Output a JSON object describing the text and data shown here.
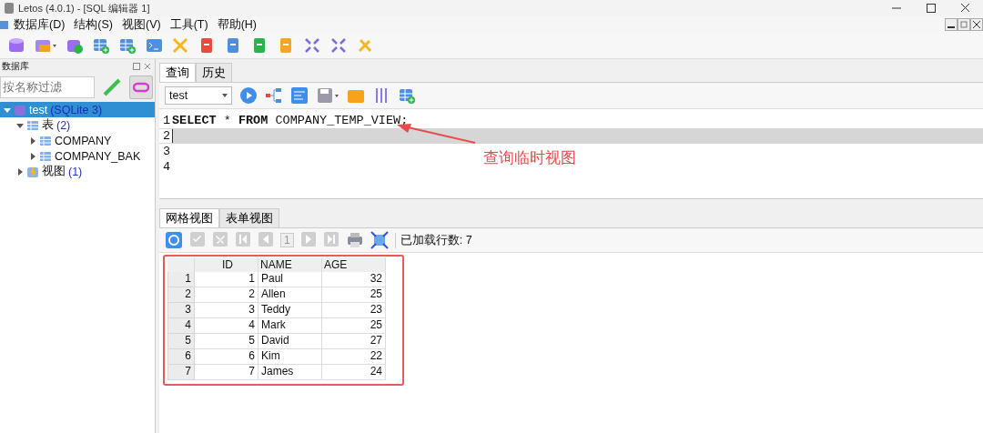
{
  "window": {
    "title": "Letos (4.0.1) - [SQL 编辑器 1]"
  },
  "menu": [
    "数据库(D)",
    "结构(S)",
    "视图(V)",
    "工具(T)",
    "帮助(H)"
  ],
  "left_panel": {
    "title": "数据库",
    "filter": {
      "placeholder": "按名称过滤"
    },
    "tree": [
      {
        "label": "test",
        "count": "(SQLite 3)",
        "expanded": true,
        "selected": true,
        "kind": "database",
        "children": [
          {
            "label": "表",
            "count": "(2)",
            "expanded": true,
            "selected": false,
            "kind": "tables",
            "children": [
              {
                "label": "COMPANY",
                "expanded": false,
                "selected": false,
                "kind": "table"
              },
              {
                "label": "COMPANY_BAK",
                "expanded": false,
                "selected": false,
                "kind": "table"
              }
            ]
          },
          {
            "label": "视图",
            "count": "(1)",
            "expanded": false,
            "selected": false,
            "kind": "views"
          }
        ]
      }
    ]
  },
  "query_tabs": [
    {
      "label": "查询",
      "selected": true
    },
    {
      "label": "历史",
      "selected": false
    }
  ],
  "connection": {
    "value": "test"
  },
  "editor": {
    "lines": [
      {
        "number": "1",
        "text": "**SELECT** * **FROM** COMPANY_TEMP_VIEW;",
        "current": false
      },
      {
        "number": "2",
        "current": true
      },
      {
        "number": "3",
        "current": false
      },
      {
        "number": "4",
        "current": false
      }
    ]
  },
  "annotation": {
    "text": "查询临时视图"
  },
  "result_tabs": [
    {
      "label": "网格视图",
      "selected": true
    },
    {
      "label": "表单视图",
      "selected": false
    }
  ],
  "pager": {
    "page": "1"
  },
  "loaded_rows": "已加载行数: 7",
  "grid": {
    "columns": [
      "ID",
      "NAME",
      "AGE"
    ],
    "rows": [
      {
        "number": "1",
        "cells": [
          "1",
          "Paul",
          "32"
        ]
      },
      {
        "number": "2",
        "cells": [
          "2",
          "Allen",
          "25"
        ]
      },
      {
        "number": "3",
        "cells": [
          "3",
          "Teddy",
          "23"
        ]
      },
      {
        "number": "4",
        "cells": [
          "4",
          "Mark",
          "25"
        ]
      },
      {
        "number": "5",
        "cells": [
          "5",
          "David",
          "27"
        ]
      },
      {
        "number": "6",
        "cells": [
          "6",
          "Kim",
          "22"
        ]
      },
      {
        "number": "7",
        "cells": [
          "7",
          "James",
          "24"
        ]
      }
    ]
  }
}
